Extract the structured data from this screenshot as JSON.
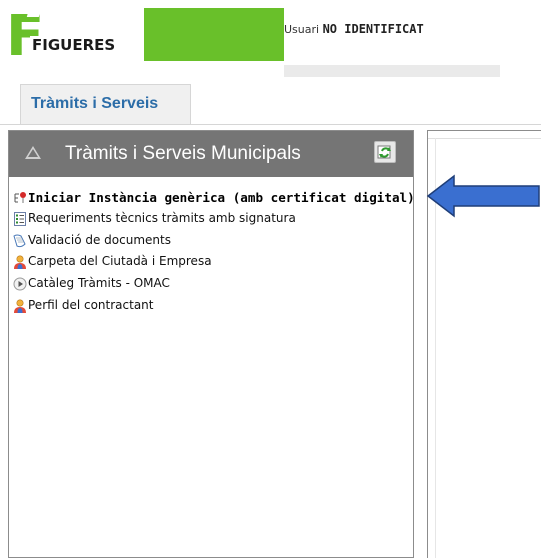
{
  "header": {
    "logo_text": "FIGUERES",
    "user_label": "Usuari",
    "user_value": "NO IDENTIFICAT"
  },
  "tab": {
    "label": "Tràmits i Serveis"
  },
  "panel": {
    "title": "Tràmits i Serveis Municipals",
    "items": [
      {
        "label": "Iniciar Instància genèrica (amb certificat digital)",
        "icon": "certificate-pin-icon",
        "bold": true
      },
      {
        "label": "Requeriments tècnics tràmits amb signatura",
        "icon": "list-document-icon",
        "bold": false
      },
      {
        "label": "Validació de documents",
        "icon": "document-scroll-icon",
        "bold": false
      },
      {
        "label": "Carpeta del Ciutadà i Empresa",
        "icon": "user-icon",
        "bold": false
      },
      {
        "label": "Catàleg Tràmits - OMAC",
        "icon": "play-circle-icon",
        "bold": false
      },
      {
        "label": "Perfil del contractant",
        "icon": "user-icon",
        "bold": false
      }
    ]
  },
  "colors": {
    "brand_green": "#69c02a",
    "panel_header": "#757575",
    "tab_text": "#2c6da8",
    "arrow_fill": "#3a6fd0",
    "arrow_stroke": "#1f3e78"
  }
}
